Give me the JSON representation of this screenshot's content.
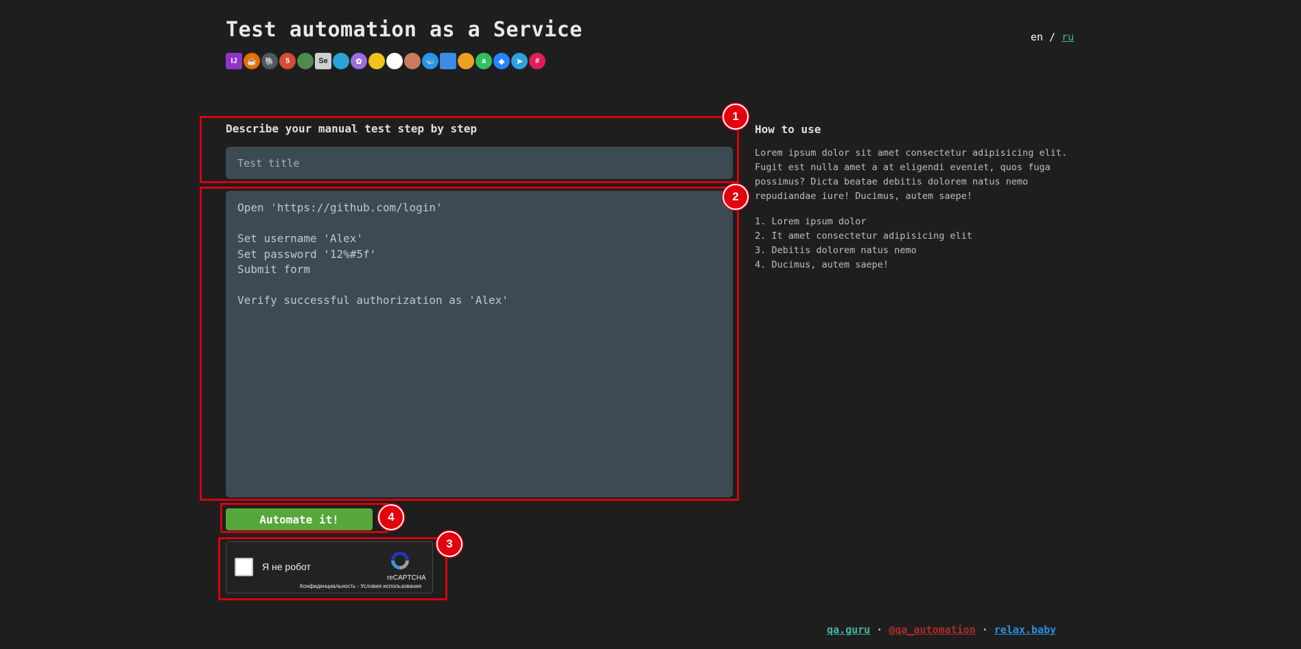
{
  "header": {
    "title": "Test automation as a Service",
    "lang_current": "en",
    "lang_separator": "/",
    "lang_other": "ru"
  },
  "tool_icons": [
    {
      "name": "intellij-idea-icon",
      "text": "IJ",
      "color": "#8e35c9"
    },
    {
      "name": "java-icon",
      "text": "☕",
      "color": "#e76f00"
    },
    {
      "name": "gradle-icon",
      "text": "🐘",
      "color": "#4d5a5f"
    },
    {
      "name": "junit5-icon",
      "text": "5",
      "color": "#d94a38"
    },
    {
      "name": "selenide-icon",
      "text": "",
      "color": "#4f8a4e"
    },
    {
      "name": "selenium-icon",
      "text": "Se",
      "color": "#cfcfcf"
    },
    {
      "name": "selenoid-icon",
      "text": "",
      "color": "#2aa4d5"
    },
    {
      "name": "allure-testops-icon",
      "text": "✿",
      "color": "#9b6fe0"
    },
    {
      "name": "allure-report-icon",
      "text": "",
      "color": "#f1c21b"
    },
    {
      "name": "github-icon",
      "text": "",
      "color": "#ffffff"
    },
    {
      "name": "jenkins-icon",
      "text": "",
      "color": "#c97c5d"
    },
    {
      "name": "docker-icon",
      "text": "🐳",
      "color": "#2496ed"
    },
    {
      "name": "browserstack-icon",
      "text": "",
      "color": "#3b8be7"
    },
    {
      "name": "chrome-icon",
      "text": "",
      "color": "#f0a020"
    },
    {
      "name": "appium-icon",
      "text": "a",
      "color": "#30c060"
    },
    {
      "name": "jira-icon",
      "text": "◆",
      "color": "#2684ff"
    },
    {
      "name": "telegram-icon",
      "text": "➤",
      "color": "#2aa3df"
    },
    {
      "name": "slack-icon",
      "text": "#",
      "color": "#e01e5a"
    }
  ],
  "form": {
    "section_label": "Describe your manual test step by step",
    "title_placeholder": "Test title",
    "steps_value": "Open 'https://github.com/login'\n\nSet username 'Alex'\nSet password '12%#5f'\nSubmit form\n\nVerify successful authorization as 'Alex'",
    "submit_label": "Automate it!"
  },
  "captcha": {
    "label": "Я не робот",
    "brand": "reCAPTCHA",
    "links": "Конфиденциальность - Условия использования"
  },
  "howto": {
    "title": "How to use",
    "text": "Lorem ipsum dolor sit amet consectetur adipisicing elit. Fugit est nulla amet a at eligendi eveniet, quos fuga possimus? Dicta beatae debitis dolorem natus nemo repudiandae iure! Ducimus, autem saepe!",
    "items": [
      "1. Lorem ipsum dolor",
      "2. It amet consectetur adipisicing elit",
      "3. Debitis dolorem natus nemo",
      "4. Ducimus, autem saepe!"
    ]
  },
  "footer": {
    "link1": "qa.guru",
    "sep1": "·",
    "link2": "@qa_automation",
    "sep2": "·",
    "link3": "relax.baby"
  },
  "markers": [
    "1",
    "2",
    "3",
    "4"
  ],
  "colors": {
    "background": "#1e1e1e",
    "input_bg": "#3c4a53",
    "button": "#56a83a",
    "annotation": "#d9000d"
  }
}
